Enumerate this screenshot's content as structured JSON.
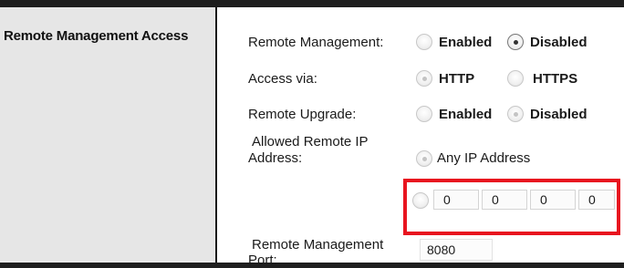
{
  "sidebar": {
    "section_title": "Remote Management Access"
  },
  "remote_management": {
    "label": "Remote  Management:",
    "options": [
      "Enabled",
      "Disabled"
    ],
    "selected": "Disabled"
  },
  "access_via": {
    "label": "Access via:",
    "options": [
      "HTTP",
      "HTTPS"
    ],
    "selected": "HTTP"
  },
  "remote_upgrade": {
    "label": "Remote Upgrade:",
    "options": [
      "Enabled",
      "Disabled"
    ],
    "selected": "Disabled"
  },
  "allowed_ip": {
    "label_line1": "Allowed Remote IP",
    "label_line2": "Address:",
    "any_option": "Any IP Address",
    "ip_octets": [
      "0",
      "0",
      "0",
      "0"
    ],
    "separator": "."
  },
  "port": {
    "label_line1": "Remote Management",
    "label_line2": "Port:",
    "value": "8080"
  },
  "colors": {
    "highlight_border": "#e8141f",
    "sidebar_bg": "#e6e6e6"
  }
}
